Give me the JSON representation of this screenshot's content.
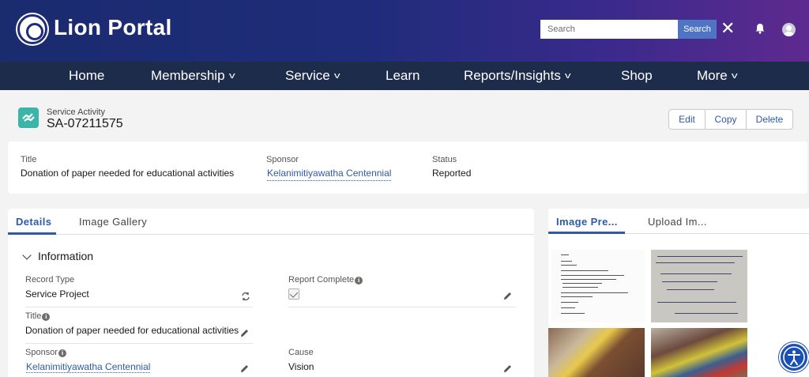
{
  "header": {
    "brand": "Lion Portal",
    "search_placeholder": "Search",
    "search_button": "Search"
  },
  "nav": {
    "items": [
      {
        "label": "Home"
      },
      {
        "label": "Membership"
      },
      {
        "label": "Service"
      },
      {
        "label": "Learn"
      },
      {
        "label": "Reports/Insights"
      },
      {
        "label": "Shop"
      },
      {
        "label": "More"
      }
    ]
  },
  "record": {
    "type": "Service Activity",
    "name": "SA-07211575",
    "actions": {
      "edit": "Edit",
      "copy": "Copy",
      "delete": "Delete"
    }
  },
  "highlights": {
    "title_label": "Title",
    "title_value": "Donation of paper needed for educational activities",
    "sponsor_label": "Sponsor",
    "sponsor_value": "Kelanimitiyawatha Centennial",
    "status_label": "Status",
    "status_value": "Reported"
  },
  "details": {
    "tabs": [
      "Details",
      "Image Gallery"
    ],
    "section": "Information",
    "fields": {
      "record_type_label": "Record Type",
      "record_type_value": "Service Project",
      "report_complete_label": "Report Complete",
      "report_complete_checked": true,
      "title_label": "Title",
      "title_value": "Donation of paper needed for educational activities",
      "sponsor_label": "Sponsor",
      "sponsor_value": "Kelanimitiyawatha Centennial",
      "cause_label": "Cause",
      "cause_value": "Vision"
    }
  },
  "image_panel": {
    "tabs": [
      "Image Pre...",
      "Upload Im..."
    ]
  },
  "colors": {
    "accent": "#2e5aa8",
    "nav_bg": "#1c2c4a",
    "record_icon": "#3bb5a9"
  }
}
